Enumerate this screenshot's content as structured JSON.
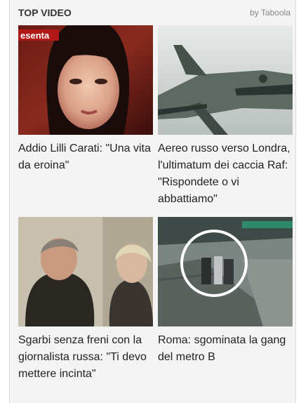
{
  "widget": {
    "title": "TOP VIDEO",
    "attribution": "by Taboola"
  },
  "cards": [
    {
      "caption": "Addio Lilli Carati: \"Una vita da eroina\"",
      "overlay_text": "esenta"
    },
    {
      "caption": "Aereo russo verso Londra, l'ultimatum dei caccia Raf: \"Rispondete o vi abbattiamo\""
    },
    {
      "caption": "Sgarbi senza freni con la giornalista russa: \"Ti devo mettere incinta\""
    },
    {
      "caption": "Roma: sgominata la gang del metro B"
    }
  ]
}
